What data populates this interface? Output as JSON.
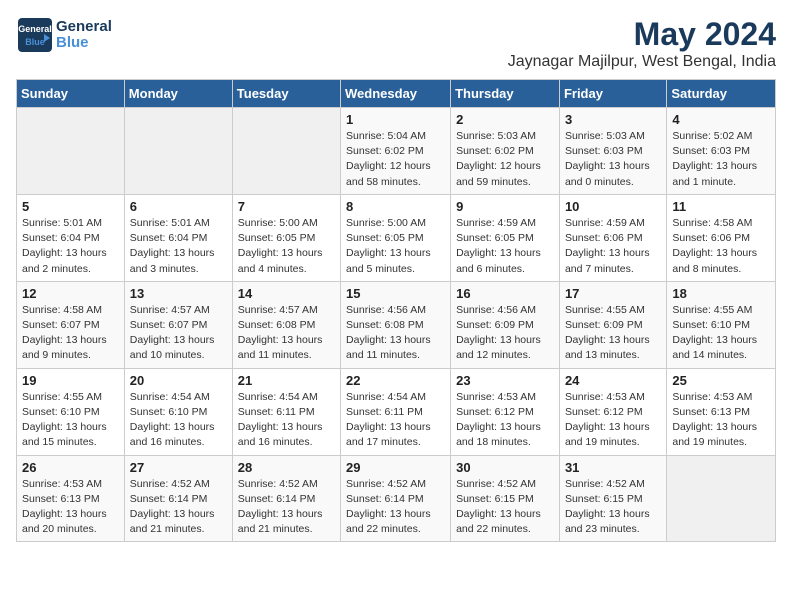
{
  "header": {
    "logo_general": "General",
    "logo_blue": "Blue",
    "title": "May 2024",
    "subtitle": "Jaynagar Majilpur, West Bengal, India"
  },
  "calendar": {
    "days_of_week": [
      "Sunday",
      "Monday",
      "Tuesday",
      "Wednesday",
      "Thursday",
      "Friday",
      "Saturday"
    ],
    "weeks": [
      [
        {
          "day": "",
          "info": ""
        },
        {
          "day": "",
          "info": ""
        },
        {
          "day": "",
          "info": ""
        },
        {
          "day": "1",
          "info": "Sunrise: 5:04 AM\nSunset: 6:02 PM\nDaylight: 12 hours\nand 58 minutes."
        },
        {
          "day": "2",
          "info": "Sunrise: 5:03 AM\nSunset: 6:02 PM\nDaylight: 12 hours\nand 59 minutes."
        },
        {
          "day": "3",
          "info": "Sunrise: 5:03 AM\nSunset: 6:03 PM\nDaylight: 13 hours\nand 0 minutes."
        },
        {
          "day": "4",
          "info": "Sunrise: 5:02 AM\nSunset: 6:03 PM\nDaylight: 13 hours\nand 1 minute."
        }
      ],
      [
        {
          "day": "5",
          "info": "Sunrise: 5:01 AM\nSunset: 6:04 PM\nDaylight: 13 hours\nand 2 minutes."
        },
        {
          "day": "6",
          "info": "Sunrise: 5:01 AM\nSunset: 6:04 PM\nDaylight: 13 hours\nand 3 minutes."
        },
        {
          "day": "7",
          "info": "Sunrise: 5:00 AM\nSunset: 6:05 PM\nDaylight: 13 hours\nand 4 minutes."
        },
        {
          "day": "8",
          "info": "Sunrise: 5:00 AM\nSunset: 6:05 PM\nDaylight: 13 hours\nand 5 minutes."
        },
        {
          "day": "9",
          "info": "Sunrise: 4:59 AM\nSunset: 6:05 PM\nDaylight: 13 hours\nand 6 minutes."
        },
        {
          "day": "10",
          "info": "Sunrise: 4:59 AM\nSunset: 6:06 PM\nDaylight: 13 hours\nand 7 minutes."
        },
        {
          "day": "11",
          "info": "Sunrise: 4:58 AM\nSunset: 6:06 PM\nDaylight: 13 hours\nand 8 minutes."
        }
      ],
      [
        {
          "day": "12",
          "info": "Sunrise: 4:58 AM\nSunset: 6:07 PM\nDaylight: 13 hours\nand 9 minutes."
        },
        {
          "day": "13",
          "info": "Sunrise: 4:57 AM\nSunset: 6:07 PM\nDaylight: 13 hours\nand 10 minutes."
        },
        {
          "day": "14",
          "info": "Sunrise: 4:57 AM\nSunset: 6:08 PM\nDaylight: 13 hours\nand 11 minutes."
        },
        {
          "day": "15",
          "info": "Sunrise: 4:56 AM\nSunset: 6:08 PM\nDaylight: 13 hours\nand 11 minutes."
        },
        {
          "day": "16",
          "info": "Sunrise: 4:56 AM\nSunset: 6:09 PM\nDaylight: 13 hours\nand 12 minutes."
        },
        {
          "day": "17",
          "info": "Sunrise: 4:55 AM\nSunset: 6:09 PM\nDaylight: 13 hours\nand 13 minutes."
        },
        {
          "day": "18",
          "info": "Sunrise: 4:55 AM\nSunset: 6:10 PM\nDaylight: 13 hours\nand 14 minutes."
        }
      ],
      [
        {
          "day": "19",
          "info": "Sunrise: 4:55 AM\nSunset: 6:10 PM\nDaylight: 13 hours\nand 15 minutes."
        },
        {
          "day": "20",
          "info": "Sunrise: 4:54 AM\nSunset: 6:10 PM\nDaylight: 13 hours\nand 16 minutes."
        },
        {
          "day": "21",
          "info": "Sunrise: 4:54 AM\nSunset: 6:11 PM\nDaylight: 13 hours\nand 16 minutes."
        },
        {
          "day": "22",
          "info": "Sunrise: 4:54 AM\nSunset: 6:11 PM\nDaylight: 13 hours\nand 17 minutes."
        },
        {
          "day": "23",
          "info": "Sunrise: 4:53 AM\nSunset: 6:12 PM\nDaylight: 13 hours\nand 18 minutes."
        },
        {
          "day": "24",
          "info": "Sunrise: 4:53 AM\nSunset: 6:12 PM\nDaylight: 13 hours\nand 19 minutes."
        },
        {
          "day": "25",
          "info": "Sunrise: 4:53 AM\nSunset: 6:13 PM\nDaylight: 13 hours\nand 19 minutes."
        }
      ],
      [
        {
          "day": "26",
          "info": "Sunrise: 4:53 AM\nSunset: 6:13 PM\nDaylight: 13 hours\nand 20 minutes."
        },
        {
          "day": "27",
          "info": "Sunrise: 4:52 AM\nSunset: 6:14 PM\nDaylight: 13 hours\nand 21 minutes."
        },
        {
          "day": "28",
          "info": "Sunrise: 4:52 AM\nSunset: 6:14 PM\nDaylight: 13 hours\nand 21 minutes."
        },
        {
          "day": "29",
          "info": "Sunrise: 4:52 AM\nSunset: 6:14 PM\nDaylight: 13 hours\nand 22 minutes."
        },
        {
          "day": "30",
          "info": "Sunrise: 4:52 AM\nSunset: 6:15 PM\nDaylight: 13 hours\nand 22 minutes."
        },
        {
          "day": "31",
          "info": "Sunrise: 4:52 AM\nSunset: 6:15 PM\nDaylight: 13 hours\nand 23 minutes."
        },
        {
          "day": "",
          "info": ""
        }
      ]
    ]
  }
}
